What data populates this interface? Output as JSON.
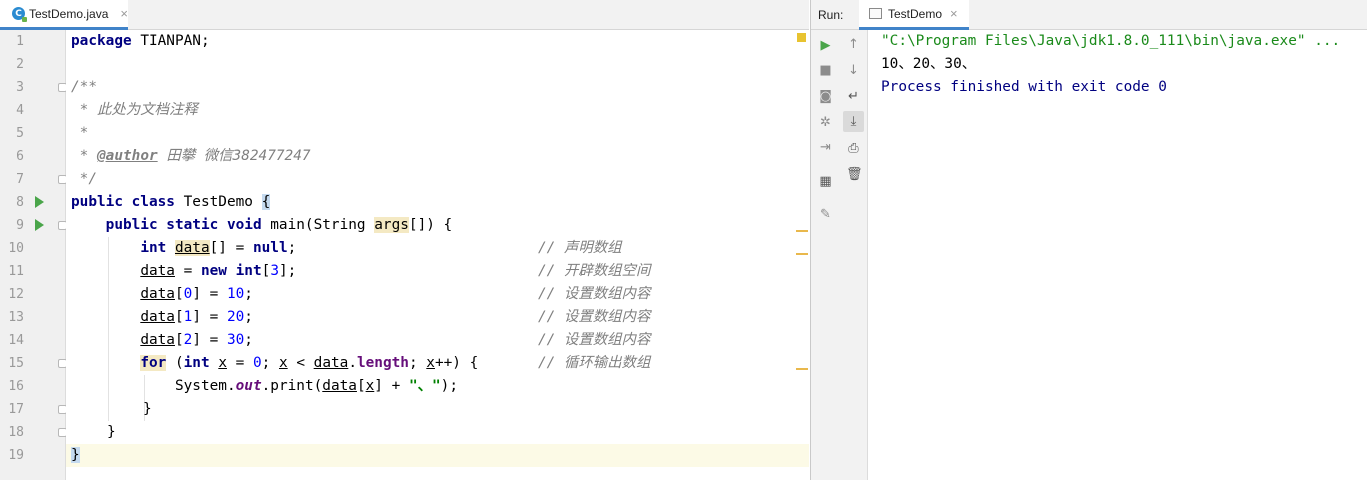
{
  "editor": {
    "tab_label": "TestDemo.java",
    "tab_close": "×",
    "lines": [
      {
        "num": "1"
      },
      {
        "num": "2"
      },
      {
        "num": "3"
      },
      {
        "num": "4"
      },
      {
        "num": "5"
      },
      {
        "num": "6"
      },
      {
        "num": "7"
      },
      {
        "num": "8"
      },
      {
        "num": "9"
      },
      {
        "num": "10"
      },
      {
        "num": "11"
      },
      {
        "num": "12"
      },
      {
        "num": "13"
      },
      {
        "num": "14"
      },
      {
        "num": "15"
      },
      {
        "num": "16"
      },
      {
        "num": "17"
      },
      {
        "num": "18"
      },
      {
        "num": "19"
      }
    ],
    "code": {
      "l1_kw": "package",
      "l1_rest": " TIANPAN;",
      "l3": "/**",
      "l4": " * 此处为文档注释",
      "l5": " *",
      "l6_a": " * ",
      "l6_tag": "@author",
      "l6_b": " 田攀 微信382477247",
      "l7": " */",
      "l8_kw": "public class",
      "l8_rest": " TestDemo ",
      "l8_brace": "{",
      "l9_kw": "public static void",
      "l9_a": " main(String ",
      "l9_var": "args",
      "l9_b": "[]) {",
      "l10_kw": "int",
      "l10_var": "data",
      "l10_a": "[] = ",
      "l10_null": "null",
      "l10_b": ";",
      "l10_cmt": "// 声明数组",
      "l11_var": "data",
      "l11_a": " = ",
      "l11_new": "new",
      "l11_int": "int",
      "l11_b": "[",
      "l11_n": "3",
      "l11_c": "];",
      "l11_cmt": "// 开辟数组空间",
      "l12_var": "data",
      "l12_a": "[",
      "l12_i": "0",
      "l12_b": "] = ",
      "l12_v": "10",
      "l12_c": ";",
      "l12_cmt": "// 设置数组内容",
      "l13_var": "data",
      "l13_a": "[",
      "l13_i": "1",
      "l13_b": "] = ",
      "l13_v": "20",
      "l13_c": ";",
      "l13_cmt": "// 设置数组内容",
      "l14_var": "data",
      "l14_a": "[",
      "l14_i": "2",
      "l14_b": "] = ",
      "l14_v": "30",
      "l14_c": ";",
      "l14_cmt": "// 设置数组内容",
      "l15_for": "for",
      "l15_a": " (",
      "l15_int": "int",
      "l15_x1": "x",
      "l15_b": " = ",
      "l15_zero": "0",
      "l15_c": "; ",
      "l15_x2": "x",
      "l15_d": " < ",
      "l15_data": "data",
      "l15_e": ".",
      "l15_len": "length",
      "l15_f": "; ",
      "l15_x3": "x",
      "l15_g": "++) {",
      "l15_cmt": "// 循环输出数组",
      "l16_a": "System.",
      "l16_out": "out",
      "l16_b": ".print(",
      "l16_data": "data",
      "l16_c": "[",
      "l16_x": "x",
      "l16_d": "] + ",
      "l16_str": "\"、\"",
      "l16_e": ");",
      "l17": "}",
      "l18": "}",
      "l19": "}"
    }
  },
  "run": {
    "label": "Run:",
    "tab_label": "TestDemo",
    "tab_close": "×",
    "console": {
      "line1": "\"C:\\Program Files\\Java\\jdk1.8.0_111\\bin\\java.exe\" ...",
      "line2": "10、20、30、",
      "line3": "Process finished with exit code 0"
    },
    "toolbar_left": [
      "run-icon",
      "stop-icon",
      "camera-icon",
      "debug-icon",
      "login-icon",
      "layout-icon",
      "pin-icon"
    ],
    "toolbar_right": [
      "up-arrow-icon",
      "down-arrow-icon",
      "soft-wrap-icon",
      "scroll-to-end-icon",
      "print-icon",
      "trash-icon"
    ]
  },
  "colors": {
    "keyword": "#000080",
    "number": "#0000ff",
    "string": "#008000",
    "comment": "#808080",
    "run_accent": "#4aa54a",
    "tab_underline": "#4083c9"
  }
}
